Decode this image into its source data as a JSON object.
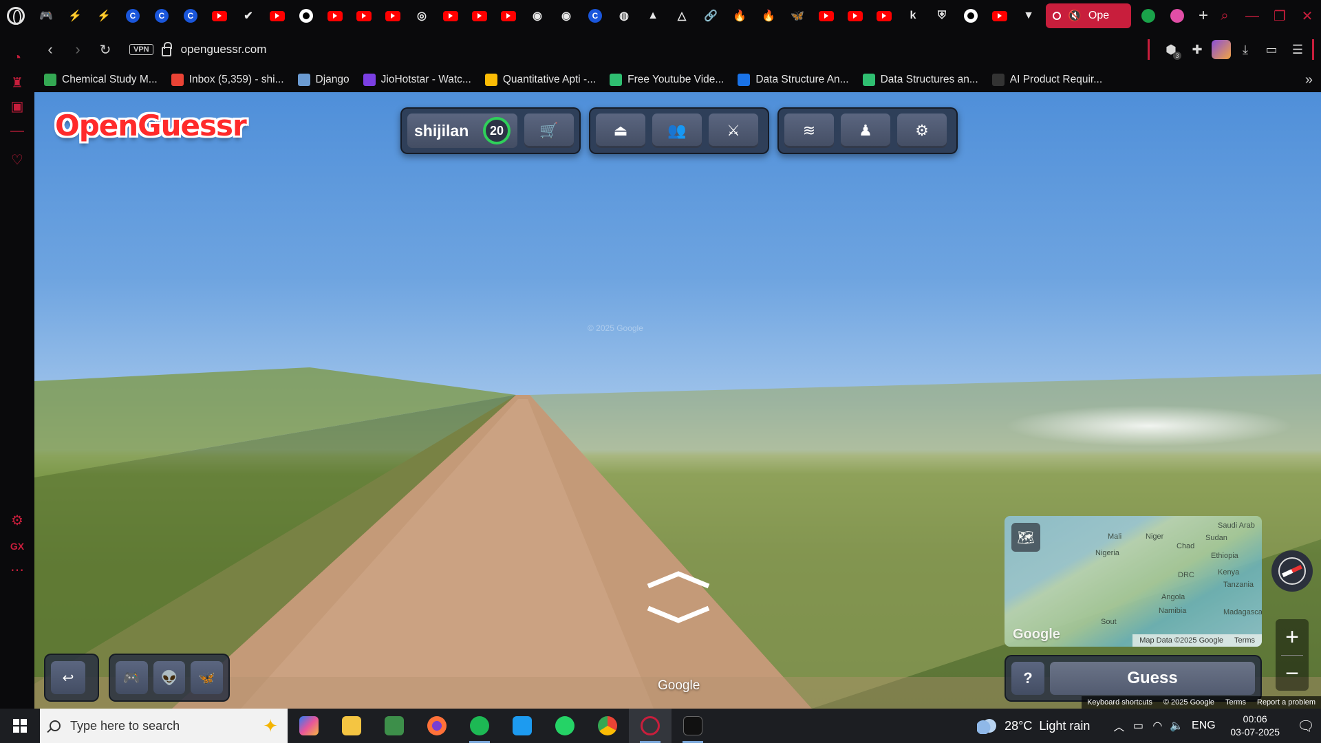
{
  "browser": {
    "url": "openguessr.com",
    "vpn_label": "VPN",
    "active_tab_title": "Ope",
    "tab_icons": [
      "gamepad-icon",
      "bolt-icon",
      "bolt-icon",
      "c-icon",
      "c-icon",
      "c-icon",
      "youtube-icon",
      "check-icon",
      "youtube-icon",
      "github-icon",
      "youtube-icon",
      "youtube-icon",
      "youtube-icon",
      "chatgpt-icon",
      "youtube-icon",
      "youtube-icon",
      "youtube-icon",
      "app-icon",
      "app-icon",
      "c-icon",
      "dribbble-icon",
      "drive-icon",
      "ai-icon",
      "link-icon",
      "fire-icon",
      "fire-icon",
      "butterfly-icon",
      "youtube-icon",
      "youtube-icon",
      "youtube-icon",
      "k-icon",
      "shield-icon",
      "github-icon",
      "youtube-icon",
      "v-icon"
    ],
    "extra_tab_icons": [
      "leaf-icon",
      "dribbble-icon"
    ],
    "extensions_badge": "3"
  },
  "bookmarks": [
    {
      "label": "Chemical Study M...",
      "color": "#34a853"
    },
    {
      "label": "Inbox (5,359) - shi...",
      "color": "#ea4335"
    },
    {
      "label": "Django",
      "color": "#6b9bd2"
    },
    {
      "label": "JioHotstar - Watc...",
      "color": "#7b3fe4"
    },
    {
      "label": "Quantitative Apti -...",
      "color": "#fbbc05"
    },
    {
      "label": "Free Youtube Vide...",
      "color": "#2fbf71"
    },
    {
      "label": "Data Structure An...",
      "color": "#1a73e8"
    },
    {
      "label": "Data Structures an...",
      "color": "#2fbf71"
    },
    {
      "label": "AI Product Requir...",
      "color": "#333333"
    }
  ],
  "game": {
    "logo": "OpenGuessr",
    "username": "shijilan",
    "level": "20",
    "watermark": "© 2025 Google",
    "google_label": "Google",
    "guess_label": "Guess",
    "help_label": "?",
    "minimap": {
      "labels": [
        "Saudi Arab",
        "Mali",
        "Niger",
        "Chad",
        "Sudan",
        "Nigeria",
        "Ethiopia",
        "DRC",
        "Kenya",
        "Tanzania",
        "Angola",
        "Namibia",
        "Madagascar",
        "Sout"
      ],
      "google_logo": "Google",
      "attribution": "Map Data ©2025 Google",
      "terms": "Terms"
    },
    "footer": {
      "shortcuts": "Keyboard shortcuts",
      "copyright": "© 2025 Google",
      "terms": "Terms",
      "report": "Report a problem"
    }
  },
  "taskbar": {
    "search_placeholder": "Type here to search",
    "weather_temp": "28°C",
    "weather_desc": "Light rain",
    "language": "ENG",
    "time": "00:06",
    "date": "03-07-2025"
  }
}
